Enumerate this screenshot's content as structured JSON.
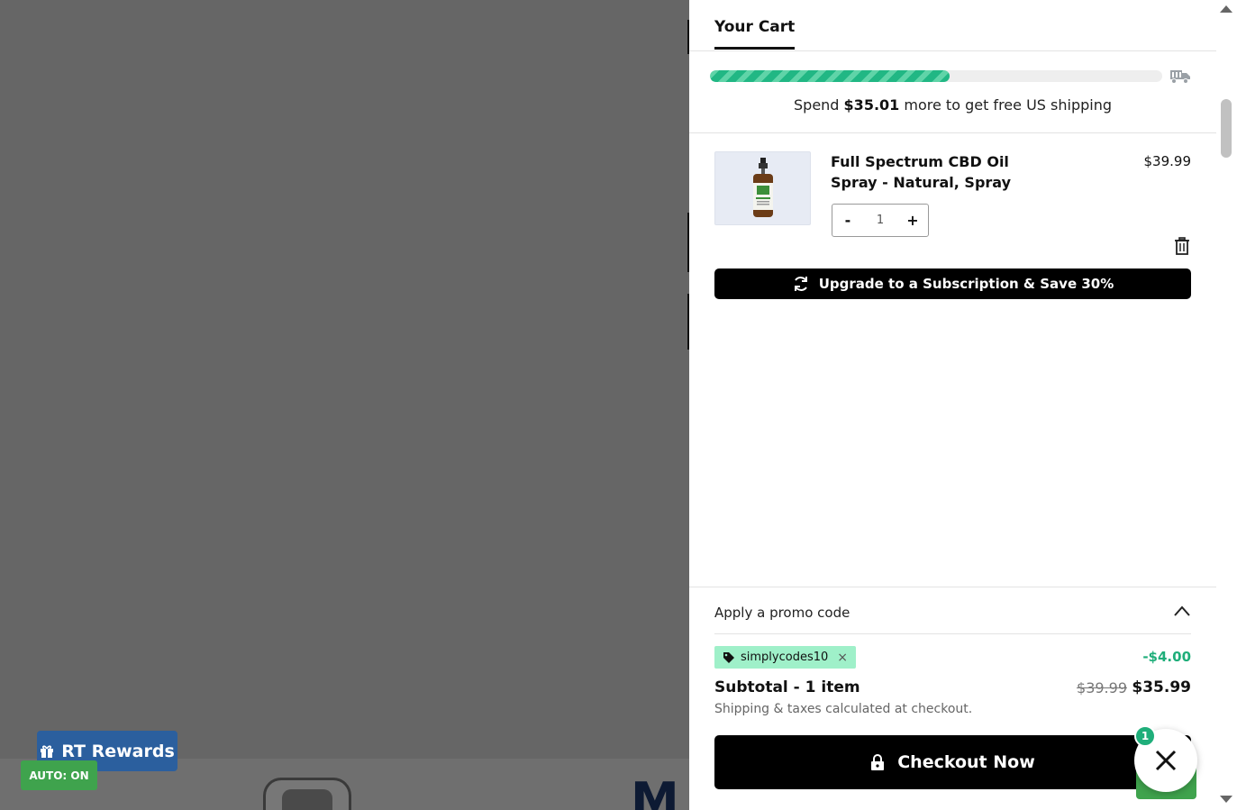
{
  "background": {
    "rewards_label": "RT Rewards",
    "auto_label": "AUTO: ON",
    "partial_heading_letter": "M"
  },
  "cart": {
    "title": "Your Cart",
    "progress_fraction": 0.53,
    "shipping": {
      "prefix": "Spend",
      "amount": "$35.01",
      "suffix": "more to get free US shipping"
    },
    "items": [
      {
        "title": "Full Spectrum CBD Oil Spray - Natural, Spray",
        "price": "$39.99",
        "quantity": "1",
        "minus_label": "-",
        "plus_label": "+"
      }
    ],
    "upgrade_label": "Upgrade to a Subscription & Save 30%",
    "promo": {
      "toggle_label": "Apply a promo code",
      "code": "simplycodes10",
      "remove_label": "×",
      "discount": "-$4.00"
    },
    "subtotal": {
      "label": "Subtotal - 1 item",
      "original": "$39.99",
      "final": "$35.99",
      "note": "Shipping & taxes calculated at checkout."
    },
    "checkout_label": "Checkout Now"
  },
  "chat": {
    "badge_count": "1"
  },
  "colors": {
    "accent_green": "#1fae7a",
    "promo_tag_bg": "#9ff0c9",
    "rewards_blue": "#2b5f9e",
    "auto_green": "#3fa34d"
  }
}
